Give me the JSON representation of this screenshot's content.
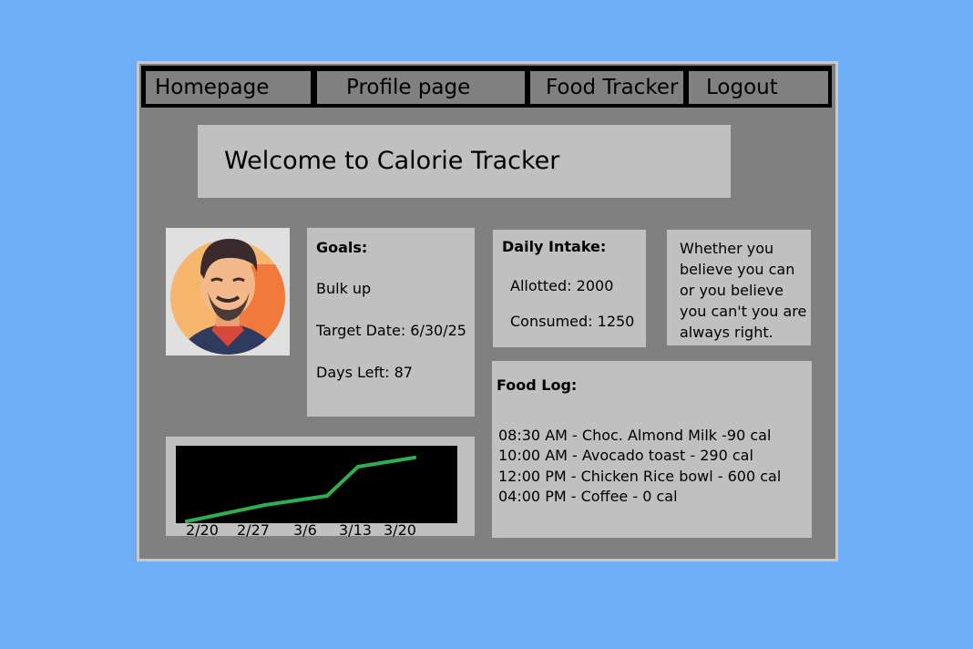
{
  "nav": {
    "items": [
      {
        "label": "Homepage"
      },
      {
        "label": "Profile page"
      },
      {
        "label": "Food Tracker"
      },
      {
        "label": "Logout"
      }
    ]
  },
  "welcome": {
    "title": "Welcome to Calorie Tracker"
  },
  "profile": {
    "avatar_icon": "user-avatar-illustration"
  },
  "goals": {
    "heading": "Goals:",
    "goal": "Bulk up",
    "target_date": "Target Date: 6/30/25",
    "days_left": "Days Left: 87"
  },
  "intake": {
    "heading": "Daily Intake:",
    "allotted": "Allotted: 2000",
    "consumed": "Consumed: 1250"
  },
  "quote": {
    "text": "Whether you believe you can or you believe you can't you are always right."
  },
  "food_log": {
    "heading": "Food Log:",
    "entries": [
      "08:30 AM - Choc. Almond Milk  -90 cal",
      "10:00 AM - Avocado toast - 290 cal",
      "12:00 PM - Chicken Rice bowl - 600 cal",
      "04:00 PM - Coffee - 0 cal"
    ]
  },
  "chart_data": {
    "type": "line",
    "categories": [
      "2/20",
      "2/27",
      "3/6",
      "3/13",
      "3/20"
    ],
    "series": [
      {
        "values": [
          2,
          20,
          30,
          62,
          72
        ],
        "color": "#2fae4f"
      }
    ],
    "ylim": [
      0,
      85
    ],
    "background": "#000000",
    "grid": false
  }
}
